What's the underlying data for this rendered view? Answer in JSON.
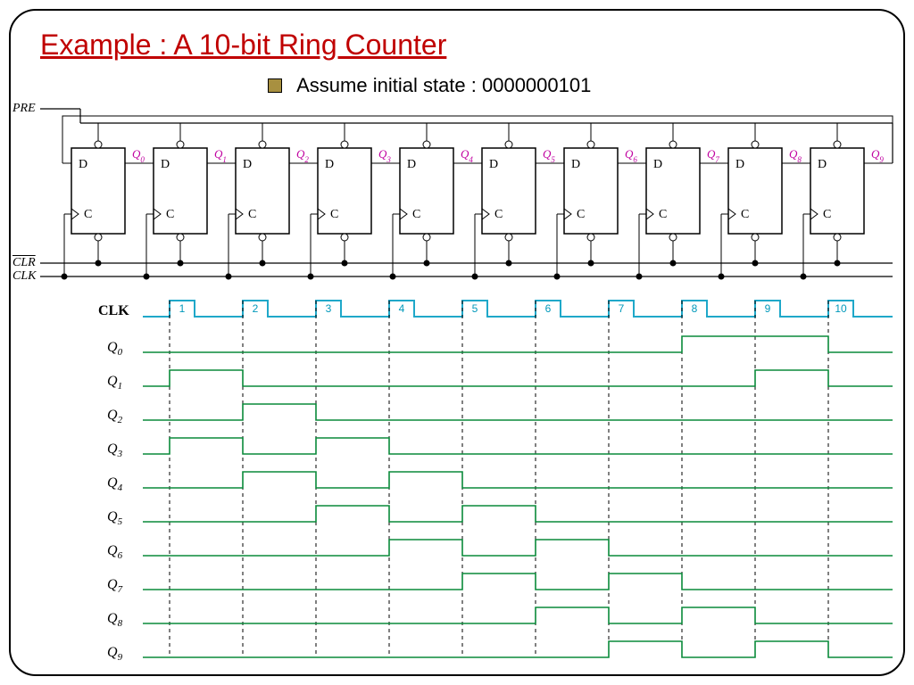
{
  "title": "Example : A 10-bit Ring Counter",
  "subtitle": "Assume initial state : 0000000101",
  "schematic": {
    "pre_label": "PRE",
    "clr_label": "CLR",
    "clk_label": "CLK",
    "flipflops": [
      {
        "d": "D",
        "c": "C",
        "q": "Q",
        "qn": "0"
      },
      {
        "d": "D",
        "c": "C",
        "q": "Q",
        "qn": "1"
      },
      {
        "d": "D",
        "c": "C",
        "q": "Q",
        "qn": "2"
      },
      {
        "d": "D",
        "c": "C",
        "q": "Q",
        "qn": "3"
      },
      {
        "d": "D",
        "c": "C",
        "q": "Q",
        "qn": "4"
      },
      {
        "d": "D",
        "c": "C",
        "q": "Q",
        "qn": "5"
      },
      {
        "d": "D",
        "c": "C",
        "q": "Q",
        "qn": "6"
      },
      {
        "d": "D",
        "c": "C",
        "q": "Q",
        "qn": "7"
      },
      {
        "d": "D",
        "c": "C",
        "q": "Q",
        "qn": "8"
      },
      {
        "d": "D",
        "c": "C",
        "q": "Q",
        "qn": "9"
      }
    ]
  },
  "timing": {
    "clk_label": "CLK",
    "clock_cycles": [
      "1",
      "2",
      "3",
      "4",
      "5",
      "6",
      "7",
      "8",
      "9",
      "10"
    ],
    "signals": [
      {
        "label_q": "Q",
        "label_sub": "0",
        "high_intervals": [
          [
            8,
            10
          ]
        ]
      },
      {
        "label_q": "Q",
        "label_sub": "1",
        "high_intervals": [
          [
            1,
            2
          ],
          [
            9,
            10
          ]
        ]
      },
      {
        "label_q": "Q",
        "label_sub": "2",
        "high_intervals": [
          [
            2,
            3
          ]
        ]
      },
      {
        "label_q": "Q",
        "label_sub": "3",
        "high_intervals": [
          [
            1,
            2
          ],
          [
            3,
            4
          ]
        ]
      },
      {
        "label_q": "Q",
        "label_sub": "4",
        "high_intervals": [
          [
            2,
            3
          ],
          [
            4,
            5
          ]
        ]
      },
      {
        "label_q": "Q",
        "label_sub": "5",
        "high_intervals": [
          [
            3,
            4
          ],
          [
            5,
            6
          ]
        ]
      },
      {
        "label_q": "Q",
        "label_sub": "6",
        "high_intervals": [
          [
            4,
            5
          ],
          [
            6,
            7
          ]
        ]
      },
      {
        "label_q": "Q",
        "label_sub": "7",
        "high_intervals": [
          [
            5,
            6
          ],
          [
            7,
            8
          ]
        ]
      },
      {
        "label_q": "Q",
        "label_sub": "8",
        "high_intervals": [
          [
            6,
            7
          ],
          [
            8,
            9
          ]
        ]
      },
      {
        "label_q": "Q",
        "label_sub": "9",
        "high_intervals": [
          [
            7,
            8
          ],
          [
            9,
            10
          ]
        ]
      }
    ]
  }
}
